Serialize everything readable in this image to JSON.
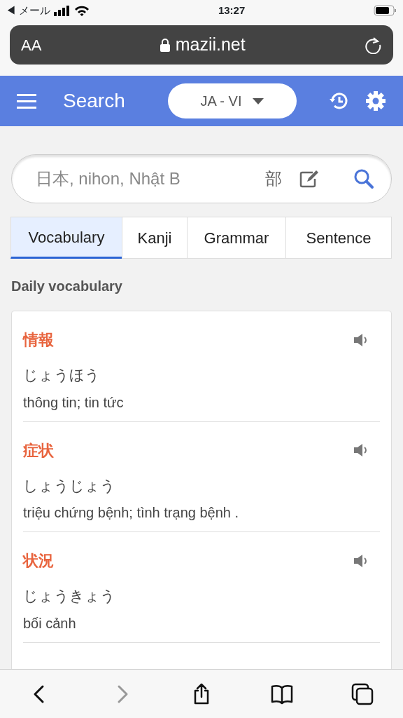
{
  "status_bar": {
    "back_label": "◀ メール",
    "time": "13:27"
  },
  "address_bar": {
    "text_size": "AA",
    "url": "mazii.net"
  },
  "header": {
    "title": "Search",
    "language": "JA - VI"
  },
  "search": {
    "placeholder": "日本, nihon, Nhật B",
    "radical": "部"
  },
  "tabs": [
    {
      "label": "Vocabulary",
      "selected": true
    },
    {
      "label": "Kanji",
      "selected": false
    },
    {
      "label": "Grammar",
      "selected": false
    },
    {
      "label": "Sentence",
      "selected": false
    }
  ],
  "section_title": "Daily vocabulary",
  "words": [
    {
      "word": "情報",
      "reading": "じょうほう",
      "meaning": "thông tin; tin tức"
    },
    {
      "word": "症状",
      "reading": "しょうじょう",
      "meaning": "triệu chứng bệnh; tình trạng bệnh ."
    },
    {
      "word": "状況",
      "reading": "じょうきょう",
      "meaning": "bối cảnh"
    }
  ],
  "toolbar": [
    {
      "kind": "back",
      "disabled": false
    },
    {
      "kind": "forward",
      "disabled": true
    },
    {
      "kind": "share",
      "disabled": false
    },
    {
      "kind": "bookmarks",
      "disabled": false
    },
    {
      "kind": "tabs",
      "disabled": false
    }
  ]
}
